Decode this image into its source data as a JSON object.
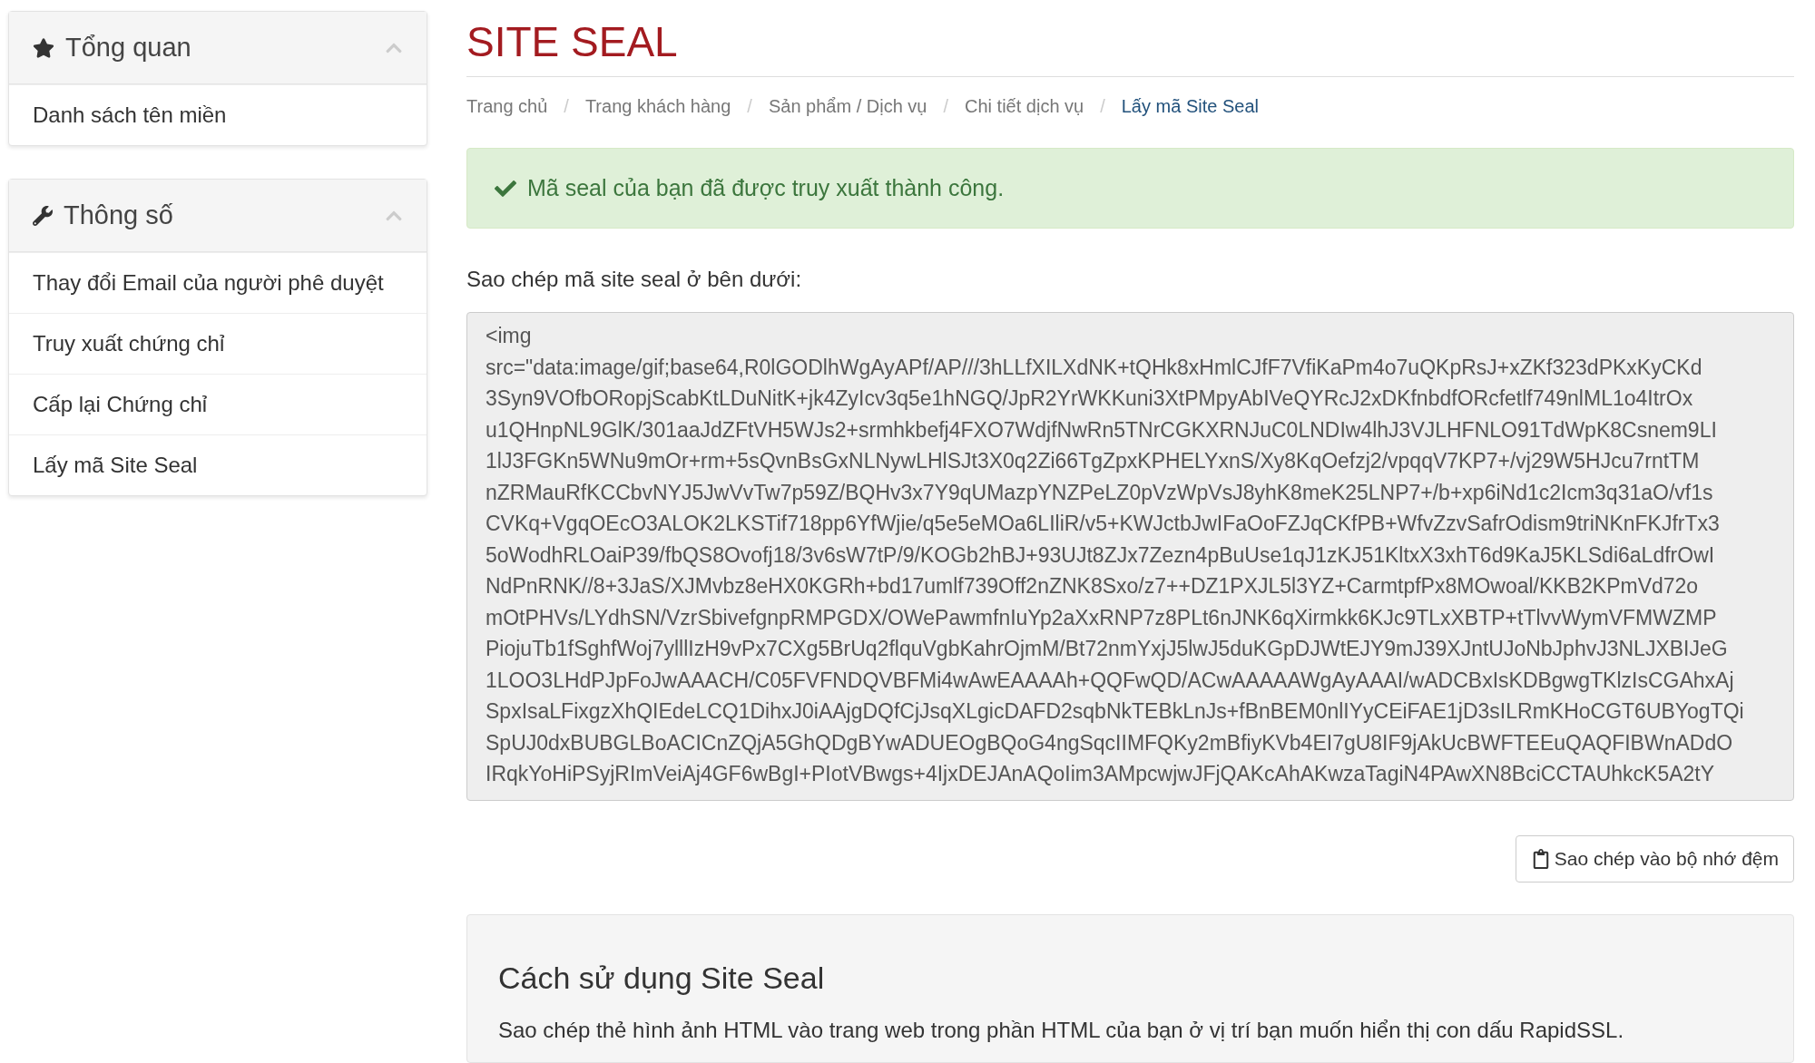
{
  "sidebar": {
    "panels": [
      {
        "title": "Tổng quan",
        "kind": "star",
        "expanded": true,
        "items": [
          {
            "label": "Danh sách tên miền"
          }
        ]
      },
      {
        "title": "Thông số",
        "kind": "wrench",
        "expanded": true,
        "items": [
          {
            "label": "Thay đổi Email của người phê duyệt"
          },
          {
            "label": "Truy xuất chứng chỉ"
          },
          {
            "label": "Cấp lại Chứng chỉ"
          },
          {
            "label": "Lấy mã Site Seal"
          }
        ]
      }
    ]
  },
  "page_title": "SITE SEAL",
  "breadcrumb": [
    {
      "label": "Trang chủ",
      "selected": false
    },
    {
      "label": "Trang khách hàng",
      "selected": false
    },
    {
      "label": "Sản phẩm / Dịch vụ",
      "selected": false
    },
    {
      "label": "Chi tiết dịch vụ",
      "selected": false
    },
    {
      "label": "Lấy mã Site Seal",
      "selected": true
    }
  ],
  "breadcrumb_separator": "/",
  "alert": {
    "text": "Mã seal của bạn đã được truy xuất thành công."
  },
  "code_label": "Sao chép mã site seal ở bên dưới:",
  "code_lines": [
    "<img",
    "src=\"data:image/gif;base64,R0lGODlhWgAyAPf/AP///3hLLfXILXdNK+tQHk8xHmlCJfF7VfiKaPm4o7uQKpRsJ+xZKf323dPKxKyCKd",
    "3Syn9VOfbORopjScabKtLDuNitK+jk4ZyIcv3q5e1hNGQ/JpR2YrWKKuni3XtPMpyAbIVeQYRcJ2xDKfnbdfORcfetlf749nlML1o4ItrOx",
    "u1QHnpNL9GlK/301aaJdZFtVH5WJs2+srmhkbefj4FXO7WdjfNwRn5TNrCGKXRNJuC0LNDIw4lhJ3VJLHFNLO91TdWpK8Csnem9LI",
    "1lJ3FGKn5WNu9mOr+rm+5sQvnBsGxNLNywLHlSJt3X0q2Zi66TgZpxKPHELYxnS/Xy8KqOefzj2/vpqqV7KP7+/vj29W5HJcu7rntTM",
    "nZRMauRfKCCbvNYJ5JwVvTw7p59Z/BQHv3x7Y9qUMazpYNZPeLZ0pVzWpVsJ8yhK8meK25LNP7+/b+xp6iNd1c2Icm3q31aO/vf1s",
    "CVKq+VgqOEcO3ALOK2LKSTif718pp6YfWjie/q5e5eMOa6LIliR/v5+KWJctbJwIFaOoFZJqCKfPB+WfvZzvSafrOdism9triNKnFKJfrTx3",
    "5oWodhRLOaiP39/fbQS8Ovofj18/3v6sW7tP/9/KOGb2hBJ+93UJt8ZJx7Zezn4pBuUse1qJ1zKJ51KltxX3xhT6d9KaJ5KLSdi6aLdfrOwI",
    "NdPnRNK//8+3JaS/XJMvbz8eHX0KGRh+bd17umlf739Off2nZNK8Sxo/z7++DZ1PXJL5l3YZ+CarmtpfPx8MOwoal/KKB2KPmVd72o",
    "mOtPHVs/LYdhSN/VzrSbivefgnpRMPGDX/OWePawmfnIuYp2aXxRNP7z8PLt6nJNK6qXirmkk6KJc9TLxXBTP+tTlvvWymVFMWZMP",
    "PiojuTb1fSghfWoj7ylllIzH9vPx7CXg5BrUq2flquVgbKahrOjmM/Bt72nmYxjJ5lwJ5duKGpDJWtEJY9mJ39XJntUJoNbJphvJ3NLJXBIJeG",
    "1LOO3LHdPJpFoJwAAACH/C05FVFNDQVBFMi4wAwEAAAAh+QQFwQD/ACwAAAAAWgAyAAAI/wADCBxIsKDBgwgTKlzIsCGAhxAj",
    "SpxIsaLFixgzXhQIEdeLCQ1DihxJ0iAAjgDQfCjJsqXLgicDAFD2sqbNkTEBkLnJs+fBnBEM0nlIYyCEiFAE1jD3sILRmKHoCGT6UBYogTQi",
    "SpUJ0dxBUBGLBoACICnZQjA5GhQDgBYwADUEOgBQoG4ngSqcIIMFQKy2mBfiyKVb4EI7gU8IF9jAkUcBWFTEEuQAQFIBWnADdO",
    "IRqkYoHiPSyjRImVeiAj4GF6wBgI+PIotVBwgs+4IjxDEJAnAQoIim3AMpcwjwJFjQAKcAhAKwzaTagiN4PAwXN8BciCCTAUhkcK5A2tY"
  ],
  "copy_button": "Sao chép vào bộ nhớ đệm",
  "usage": {
    "title": "Cách sử dụng Site Seal",
    "text": "Sao chép thẻ hình ảnh HTML vào trang web trong phần HTML của bạn ở vị trí bạn muốn hiển thị con dấu RapidSSL."
  }
}
